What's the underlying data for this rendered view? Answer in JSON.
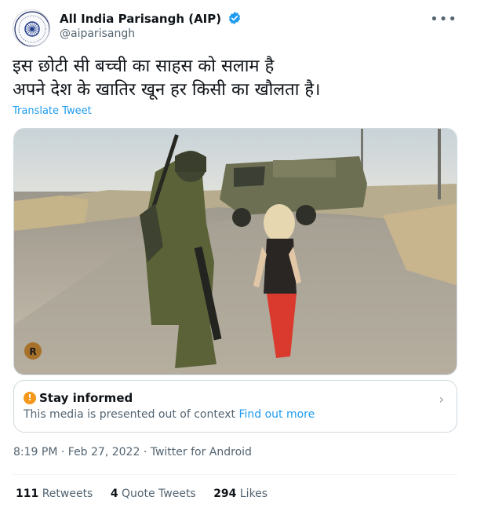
{
  "author": {
    "name": "All India Parisangh (AIP)",
    "handle": "@aiparisangh"
  },
  "tweet": {
    "text_line_1": "इस छोटी सी बच्ची का साहस को सलाम है",
    "text_line_2": "अपने देश के खातिर खून हर किसी का खौलता है।",
    "translate_label": "Translate Tweet"
  },
  "notice": {
    "title": "Stay informed",
    "body": "This media is presented out of context",
    "link": "Find out more"
  },
  "meta": {
    "time": "8:19 PM",
    "date": "Feb 27, 2022",
    "source": "Twitter for Android",
    "separator": "·"
  },
  "stats": {
    "retweets_count": "111",
    "retweets_label": "Retweets",
    "quotes_count": "4",
    "quotes_label": "Quote Tweets",
    "likes_count": "294",
    "likes_label": "Likes"
  },
  "colors": {
    "accent": "#1d9bf0",
    "warning": "#f4981c",
    "muted_text": "#536471"
  },
  "icons": {
    "verified": "verified-badge-icon",
    "more": "more-options-icon",
    "warning": "info-warning-icon",
    "chevron": "chevron-right-icon"
  }
}
